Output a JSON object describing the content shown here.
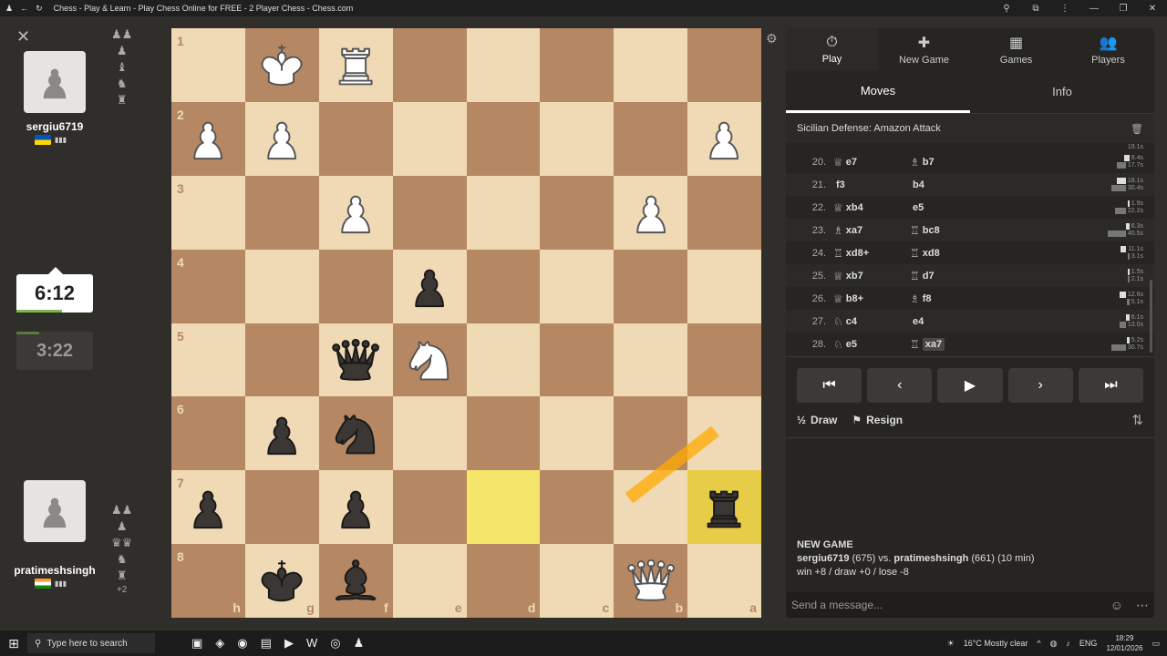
{
  "window": {
    "title": "Chess - Play & Learn - Play Chess Online for FREE - 2 Player Chess - Chess.com"
  },
  "players": {
    "top": {
      "name": "sergiu6719",
      "flag_colors": [
        "#0057b7",
        "#ffd700"
      ]
    },
    "bottom": {
      "name": "pratimeshsingh",
      "flag_colors": [
        "#ff9933",
        "#ffffff",
        "#138808"
      ],
      "material_advantage": "+2"
    }
  },
  "clocks": {
    "active": "6:12",
    "idle": "3:22"
  },
  "board": {
    "ranks": [
      "1",
      "2",
      "3",
      "4",
      "5",
      "6",
      "7",
      "8"
    ],
    "files": [
      "h",
      "g",
      "f",
      "e",
      "d",
      "c",
      "b",
      "a"
    ],
    "pieces": [
      {
        "sq": "g1",
        "piece": "white-king"
      },
      {
        "sq": "f1",
        "piece": "white-rook"
      },
      {
        "sq": "h2",
        "piece": "white-pawn"
      },
      {
        "sq": "g2",
        "piece": "white-pawn"
      },
      {
        "sq": "a2",
        "piece": "white-pawn"
      },
      {
        "sq": "f3",
        "piece": "white-pawn"
      },
      {
        "sq": "b3",
        "piece": "white-pawn"
      },
      {
        "sq": "e4",
        "piece": "black-pawn"
      },
      {
        "sq": "f5",
        "piece": "black-queen"
      },
      {
        "sq": "e5",
        "piece": "white-knight"
      },
      {
        "sq": "g6",
        "piece": "black-pawn"
      },
      {
        "sq": "f6",
        "piece": "black-knight"
      },
      {
        "sq": "h7",
        "piece": "black-pawn"
      },
      {
        "sq": "f7",
        "piece": "black-pawn"
      },
      {
        "sq": "a7",
        "piece": "black-rook"
      },
      {
        "sq": "g8",
        "piece": "black-king"
      },
      {
        "sq": "f8",
        "piece": "black-bishop"
      },
      {
        "sq": "b8",
        "piece": "white-queen"
      }
    ],
    "highlights": [
      "d7",
      "a7"
    ]
  },
  "tabs": [
    {
      "label": "Play",
      "icon": "stopwatch-icon",
      "active": true
    },
    {
      "label": "New Game",
      "icon": "plus-icon",
      "active": false
    },
    {
      "label": "Games",
      "icon": "board-icon",
      "active": false
    },
    {
      "label": "Players",
      "icon": "players-icon",
      "active": false
    }
  ],
  "subtabs": [
    {
      "label": "Moves",
      "active": true
    },
    {
      "label": "Info",
      "active": false
    }
  ],
  "opening": "Sicilian Defense: Amazon Attack",
  "moves": [
    {
      "num": "20.",
      "w_pc": "♕",
      "w": "e7",
      "b_pc": "♗",
      "b": "b7",
      "wt": "9.4s",
      "bt": "17.7s",
      "ww": 6,
      "bw": 10
    },
    {
      "num": "21.",
      "w_pc": "",
      "w": "f3",
      "b_pc": "",
      "b": "b4",
      "wt": "18.1s",
      "bt": "30.4s",
      "ww": 10,
      "bw": 16
    },
    {
      "num": "22.",
      "w_pc": "♕",
      "w": "xb4",
      "b_pc": "",
      "b": "e5",
      "wt": "1.9s",
      "bt": "22.2s",
      "ww": 2,
      "bw": 12
    },
    {
      "num": "23.",
      "w_pc": "♗",
      "w": "xa7",
      "b_pc": "♖",
      "b": "bc8",
      "wt": "6.3s",
      "bt": "40.5s",
      "ww": 4,
      "bw": 20
    },
    {
      "num": "24.",
      "w_pc": "♖",
      "w": "xd8+",
      "b_pc": "♖",
      "b": "xd8",
      "wt": "11.1s",
      "bt": "3.1s",
      "ww": 6,
      "bw": 2
    },
    {
      "num": "25.",
      "w_pc": "♕",
      "w": "xb7",
      "b_pc": "♖",
      "b": "d7",
      "wt": "1.5s",
      "bt": "2.1s",
      "ww": 2,
      "bw": 2
    },
    {
      "num": "26.",
      "w_pc": "♕",
      "w": "b8+",
      "b_pc": "♗",
      "b": "f8",
      "wt": "12.6s",
      "bt": "5.1s",
      "ww": 7,
      "bw": 3
    },
    {
      "num": "27.",
      "w_pc": "♘",
      "w": "c4",
      "b_pc": "",
      "b": "e4",
      "wt": "6.1s",
      "bt": "13.0s",
      "ww": 4,
      "bw": 7
    },
    {
      "num": "28.",
      "w_pc": "♘",
      "w": "e5",
      "b_pc": "♖",
      "b": "xa7",
      "wt": "5.2s",
      "bt": "30.7s",
      "ww": 3,
      "bw": 16
    }
  ],
  "partial_row": {
    "top_time": "19.1s"
  },
  "controls": [
    "first-move",
    "previous-move",
    "play",
    "next-move",
    "last-move"
  ],
  "actions": {
    "draw": "Draw",
    "draw_icon": "½",
    "resign": "Resign"
  },
  "new_game": {
    "heading": "NEW GAME",
    "p1": "sergiu6719",
    "p1_rating": "(675)",
    "vs": "vs.",
    "p2": "pratimeshsingh",
    "p2_rating": "(661)",
    "time_control": "(10 min)",
    "result": "win +8 / draw +0 / lose -8"
  },
  "message_placeholder": "Send a message...",
  "taskbar": {
    "search": "Type here to search",
    "weather": "16°C  Mostly clear",
    "lang": "ENG",
    "time": "18:29",
    "date": "12/01/2026"
  }
}
